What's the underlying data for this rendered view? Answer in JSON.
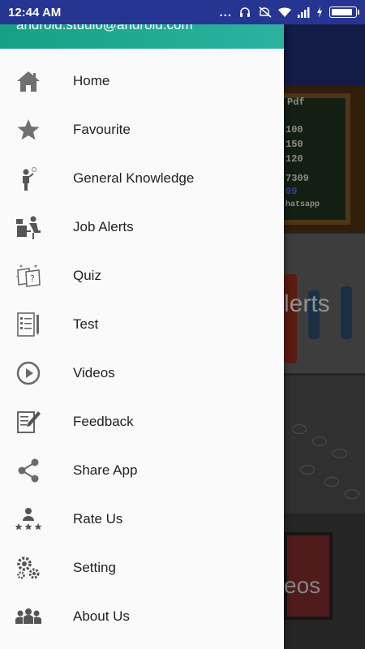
{
  "status_bar": {
    "time": "12:44 AM",
    "dots": "...",
    "icons": [
      "headset-icon",
      "mute-icon",
      "wifi-icon",
      "signal-icon",
      "charging-icon",
      "battery-icon"
    ],
    "battery_level": 0.95
  },
  "drawer": {
    "header_email": "android.studio@android.com",
    "items": [
      {
        "label": "Home",
        "icon": "home-icon"
      },
      {
        "label": "Favourite",
        "icon": "star-icon"
      },
      {
        "label": "General Knowledge",
        "icon": "person-idea-icon"
      },
      {
        "label": "Job Alerts",
        "icon": "desk-worker-icon"
      },
      {
        "label": "Quiz",
        "icon": "quiz-icon"
      },
      {
        "label": "Test",
        "icon": "test-sheet-icon"
      },
      {
        "label": "Videos",
        "icon": "play-circle-icon"
      },
      {
        "label": "Feedback",
        "icon": "feedback-icon"
      },
      {
        "label": "Share App",
        "icon": "share-icon"
      },
      {
        "label": "Rate Us",
        "icon": "rate-us-icon"
      },
      {
        "label": "Setting",
        "icon": "gears-icon"
      },
      {
        "label": "About Us",
        "icon": "group-icon"
      }
    ]
  },
  "background": {
    "card1_lines": [
      "Pdf",
      "100",
      "150",
      "120",
      "7309",
      "09",
      "hatsapp"
    ],
    "card2_text": "lerts",
    "card4_text": "eos"
  },
  "colors": {
    "status_bar": "#273592",
    "header": "#16a085",
    "icon": "#757575",
    "text": "#212121"
  }
}
